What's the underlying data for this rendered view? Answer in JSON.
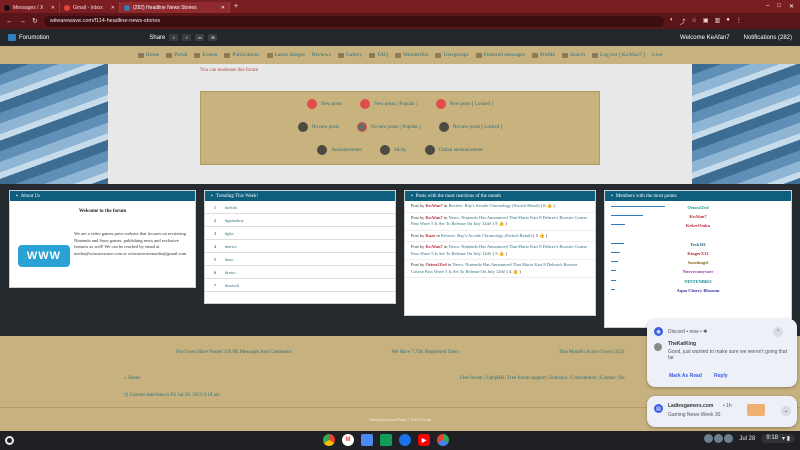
{
  "browser": {
    "tabs": [
      {
        "label": "Messages / X",
        "color": "#111111"
      },
      {
        "label": "Gmail - Inbox",
        "color": "#ea4335"
      },
      {
        "label": "(282) Headline News Stories",
        "color": "#2e7ec0"
      }
    ],
    "url": "wiiwarewave.com/f114-headline-news-stories"
  },
  "forumotion_bar": {
    "brand": "Forumotion",
    "share_label": "Share",
    "share_icons": [
      "f",
      "t",
      "m",
      "✉"
    ],
    "welcome": "Welcome KeAfan7",
    "notifications": "Notifications (282)"
  },
  "menu": [
    "Home",
    "Portal",
    "Events",
    "Publications",
    "Latest images",
    "Reviews",
    "Gallery",
    "FAQ",
    "Memberlist",
    "Usergroups",
    "Featured messages",
    "Profile",
    "Search",
    "Log out [ KeAfan7 ]",
    "Live"
  ],
  "moderate_notice": "You can moderate this forum",
  "legend": {
    "row1": [
      "New posts",
      "New posts [ Popular ]",
      "New posts [ Locked ]"
    ],
    "row2": [
      "No new posts",
      "No new posts [ Popular ]",
      "No new posts [ Locked ]"
    ],
    "row3": [
      "Announcement",
      "Sticky",
      "Global announcement"
    ]
  },
  "about": {
    "header": "About Us",
    "welcome": "Welcome to the forum",
    "logo_text": "WWW",
    "description": "We are a video games press website that focuses on reviewing Nintendo and Sony games, publishing news and exclusive features as well! We can be reached by email at media@wiiwarewave.com or wiiwarewavemedia@gmail.com"
  },
  "trending": {
    "header": "Trending This Week!",
    "items": [
      {
        "n": "1",
        "tag": "#zelda"
      },
      {
        "n": "2",
        "tag": "#gameboy"
      },
      {
        "n": "3",
        "tag": "#gbc"
      },
      {
        "n": "4",
        "tag": "#news"
      },
      {
        "n": "5",
        "tag": "#nso"
      },
      {
        "n": "6",
        "tag": "#retro"
      },
      {
        "n": "7",
        "tag": "#switch"
      }
    ]
  },
  "posts": {
    "header": "Posts with the most reactions of the month",
    "items": [
      {
        "pre": "Post by ",
        "user": "KeAfan7",
        "mid": " in ",
        "link": "Review: Ray's Arcade Chronology (Switch Retail)",
        "count": " ( 6 👍 )"
      },
      {
        "pre": "Post by ",
        "user": "KeAfan7",
        "mid": " in ",
        "link": "News: Nintendo Has Announced That Mario Kart 8 Deluxe's Booster Course Pass Wave 5 Is Set To Release On July 12th!",
        "count": " ( 5 👍 )"
      },
      {
        "pre": "Post by ",
        "user": "Kaze",
        "mid": " in ",
        "link": "Review: Ray's Arcade Chronology (Switch Retail)",
        "count": " ( 5 👍 )"
      },
      {
        "pre": "Post by ",
        "user": "KeAfan7",
        "mid": " in ",
        "link": "News: Nintendo Has Announced That Mario Kart 8 Deluxe's Booster Course Pass Wave 5 Is Set To Release On July 12th!",
        "count": " ( 5 👍 )"
      },
      {
        "pre": "Post by ",
        "user": "Orion1Zed",
        "mid": " in ",
        "link": "News: Nintendo Has Announced That Mario Kart 8 Deluxe's Booster Course Pass Wave 5 Is Set To Release On July 12th!",
        "count": " ( 4 👍 )"
      }
    ]
  },
  "members": {
    "header": "Members with the most points",
    "items": [
      {
        "name": "Orion1Zed",
        "color": "#1c8a8a",
        "share": 0.3
      },
      {
        "name": "KeAfan7",
        "color": "#b0303a",
        "share": 0.18
      },
      {
        "name": "KekerOtaku",
        "color": "#b0303a",
        "share": 0.08
      },
      {
        "name": "",
        "color": "#333333",
        "share": 0.0
      },
      {
        "name": "Teck101",
        "color": "#1c6a8a",
        "share": 0.07
      },
      {
        "name": "KingerX32",
        "color": "#b0303a",
        "share": 0.05
      },
      {
        "name": "Sanshingel",
        "color": "#8a6a1c",
        "share": 0.04
      },
      {
        "name": "Nurvecomyvaer",
        "color": "#9a3ab0",
        "share": 0.03
      },
      {
        "name": "NINTENBRO",
        "color": "#1c8a8a",
        "share": 0.03
      },
      {
        "name": "Aqua Cherry Blossom",
        "color": "#333399",
        "share": 0.02
      }
    ]
  },
  "stats": {
    "posted": "Our Users Have Posted 118.9K Messages And Comments",
    "registered": "We Have 7.75K Registered Users",
    "active": "This Month's Active Users (322)"
  },
  "footer": {
    "home": "Home",
    "time": "Current date/time is Fri Jul 28, 2023 9:18 am",
    "links": "Free forum | ©phpBB | Free forum support | Statistics | Contribution | Contact | Re",
    "admin": "Administration Panel | Edit Forum"
  },
  "notifications": {
    "n1": {
      "app": "Discord • now • ✱",
      "sender": "TheKatKing",
      "message": "Good, just wanted to make sure we weren't going that far",
      "mark_read": "Mark As Read",
      "reply": "Reply"
    },
    "n2": {
      "title": "Ladiesgamers.com",
      "time": "• 1h",
      "message": "Gaming News Week 30"
    }
  },
  "shelf": {
    "date": "Jul 28",
    "time": "9:18",
    "status": "▾ ▮"
  }
}
